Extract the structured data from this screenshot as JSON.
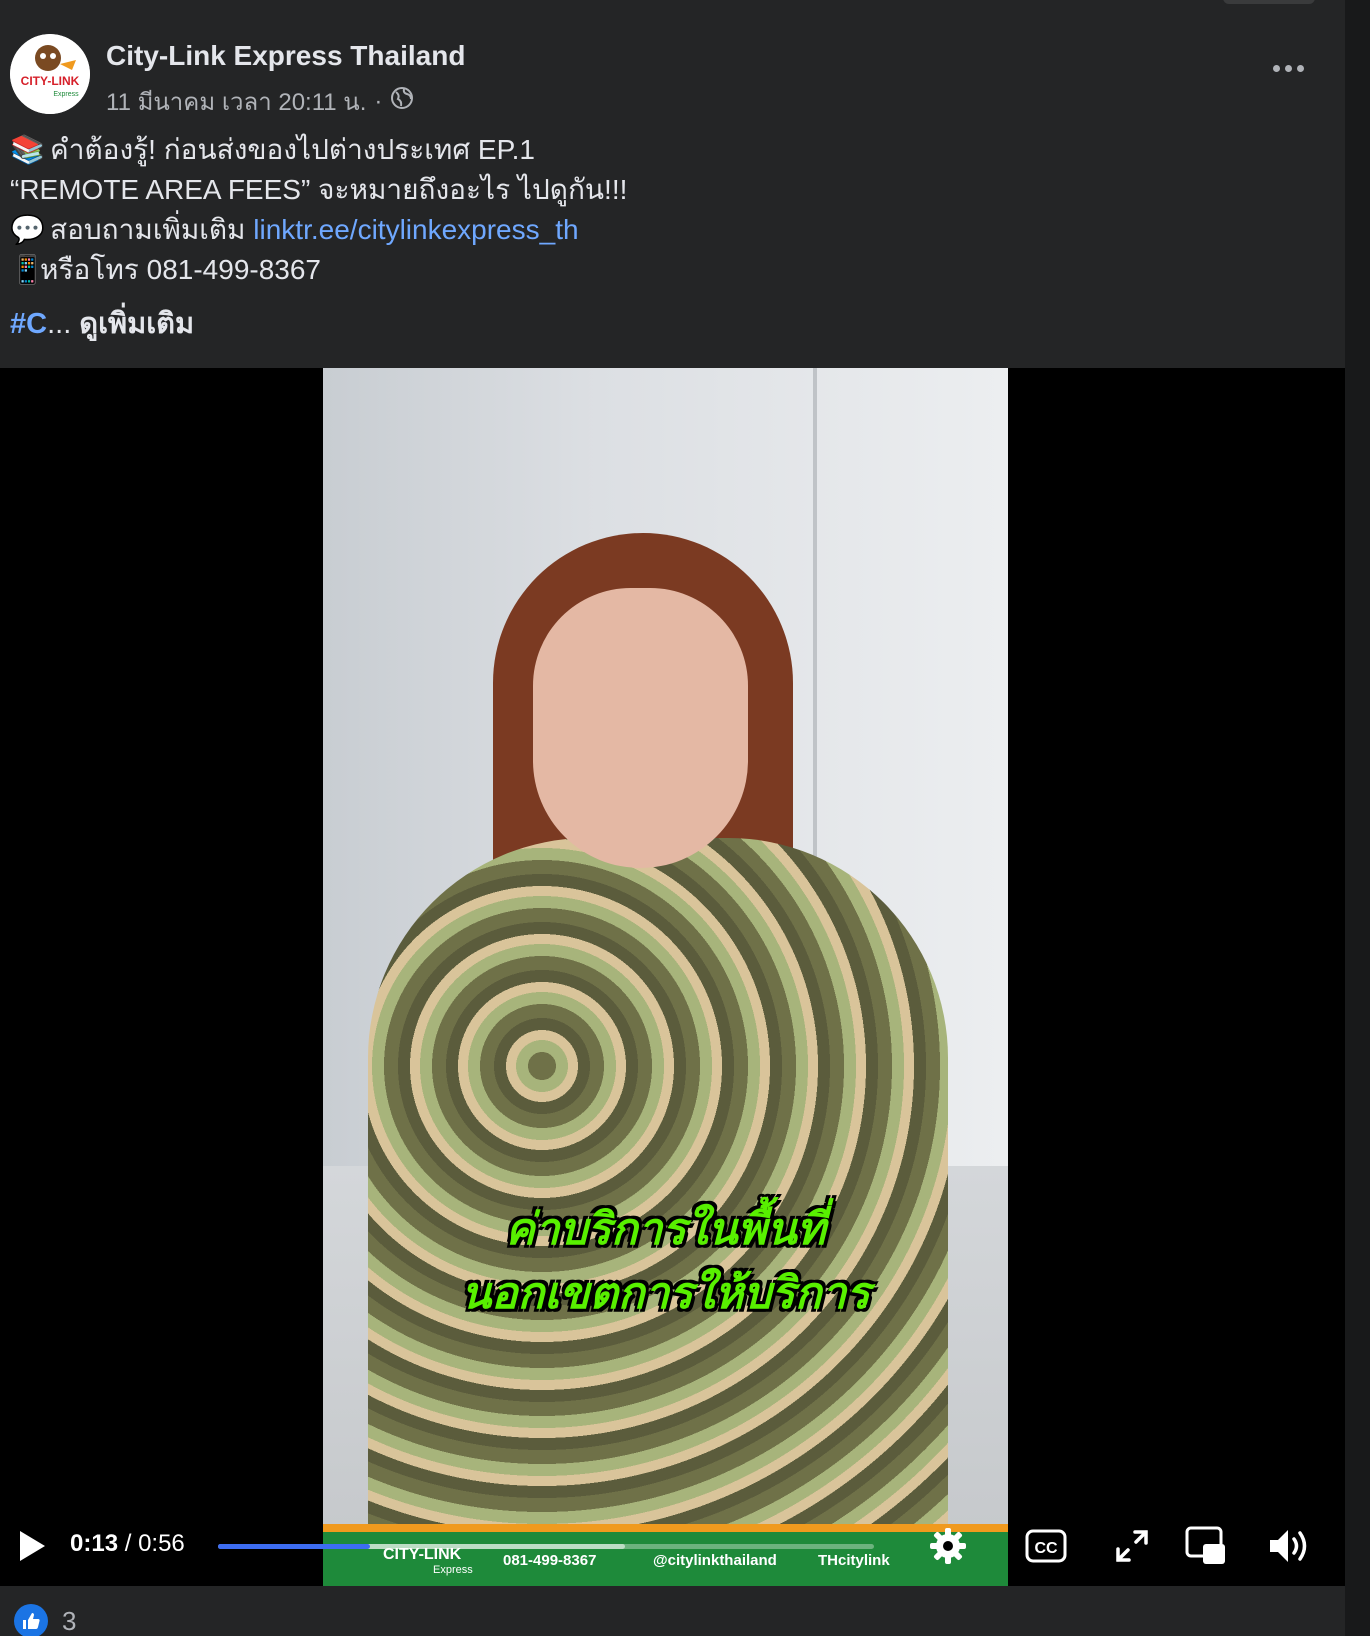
{
  "post": {
    "page_name": "City-Link Express Thailand",
    "timestamp": "11 มีนาคม เวลา 20:11 น.",
    "separator": "·",
    "privacy_icon": "globe-icon",
    "avatar": {
      "logo_text": "CITY-LINK",
      "logo_subtext": "Express"
    },
    "text": {
      "line1": {
        "emoji": "📚",
        "text": "คำต้องรู้! ก่อนส่งของไปต่างประเทศ EP.1"
      },
      "line2": {
        "text": "“REMOTE AREA FEES” จะหมายถึงอะไร ไปดูกัน!!!"
      },
      "line3": {
        "emoji": "💬",
        "text": "สอบถามเพิ่มเติม ",
        "link": "linktr.ee/citylinkexpress_th"
      },
      "line4": {
        "emoji": "📱",
        "text": "หรือโทร 081-499-8367"
      },
      "hashtag": "#C",
      "ellipsis": "...",
      "see_more": "ดูเพิ่มเติม"
    }
  },
  "video": {
    "caption_line1": "ค่าบริการในพื้นที่",
    "caption_line2": "นอกเขตการให้บริการ",
    "band": {
      "brand": "CITY-LINK",
      "brand_sub": "Express",
      "phone": "081-499-8367",
      "line_id": "@citylinkthailand",
      "messenger": "THcitylink"
    },
    "controls": {
      "current_time": "0:13",
      "time_sep": "/",
      "duration": "0:56",
      "played_fraction": 0.232,
      "buffered_fraction": 0.62,
      "icons": [
        "play-icon",
        "settings-icon",
        "captions-icon",
        "fullscreen-icon",
        "picture-in-picture-icon",
        "volume-icon"
      ],
      "cc_label": "CC"
    }
  },
  "reactions": {
    "icon": "like-icon",
    "count": "3"
  },
  "colors": {
    "card_bg": "#242526",
    "link": "#6fa8ff",
    "progress": "#3d6df2",
    "caption": "#58f000"
  }
}
